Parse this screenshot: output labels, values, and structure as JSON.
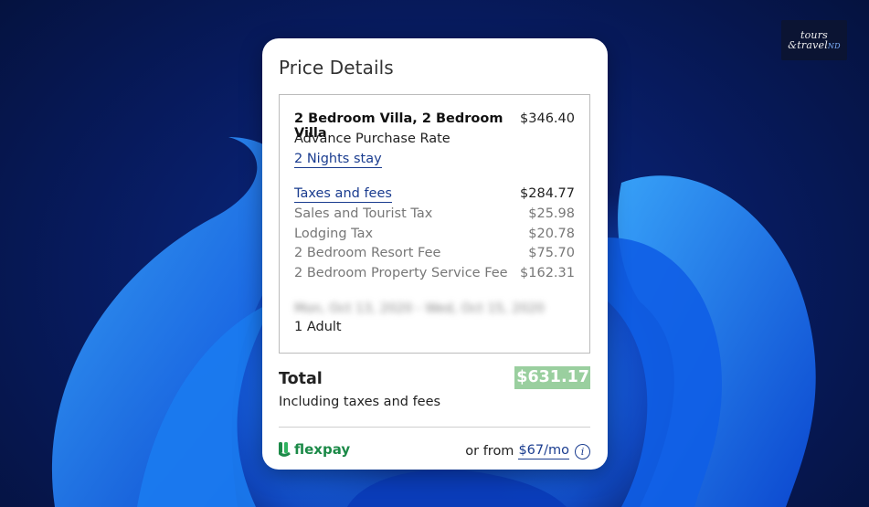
{
  "watermark": {
    "line1": "tours",
    "line2": "&travel",
    "accent": "ND"
  },
  "card": {
    "title": "Price Details",
    "room": {
      "name": "2 Bedroom Villa, 2 Bedroom Villa",
      "price": "$346.40",
      "rate": "Advance Purchase Rate",
      "nights_link": "2 Nights stay"
    },
    "taxes": {
      "label": "Taxes and fees",
      "amount": "$284.77",
      "items": [
        {
          "label": "Sales and Tourist Tax",
          "amount": "$25.98"
        },
        {
          "label": "Lodging Tax",
          "amount": "$20.78"
        },
        {
          "label": "2 Bedroom Resort Fee",
          "amount": "$75.70"
        },
        {
          "label": "2 Bedroom Property Service Fee",
          "amount": "$162.31"
        }
      ]
    },
    "dates_blurred": "Mon, Oct 13, 2020 - Wed, Oct 15, 2020",
    "guests": "1 Adult",
    "total": {
      "label": "Total",
      "amount": "$631.17",
      "note": "Including taxes and fees"
    },
    "flexpay": {
      "brand": "flexpay",
      "prefix": "or from",
      "monthly": "$67/mo",
      "info_glyph": "i"
    }
  },
  "colors": {
    "link": "#1a3c8f",
    "total_highlight": "#9acf9f",
    "flexpay_green": "#1c8a48"
  }
}
